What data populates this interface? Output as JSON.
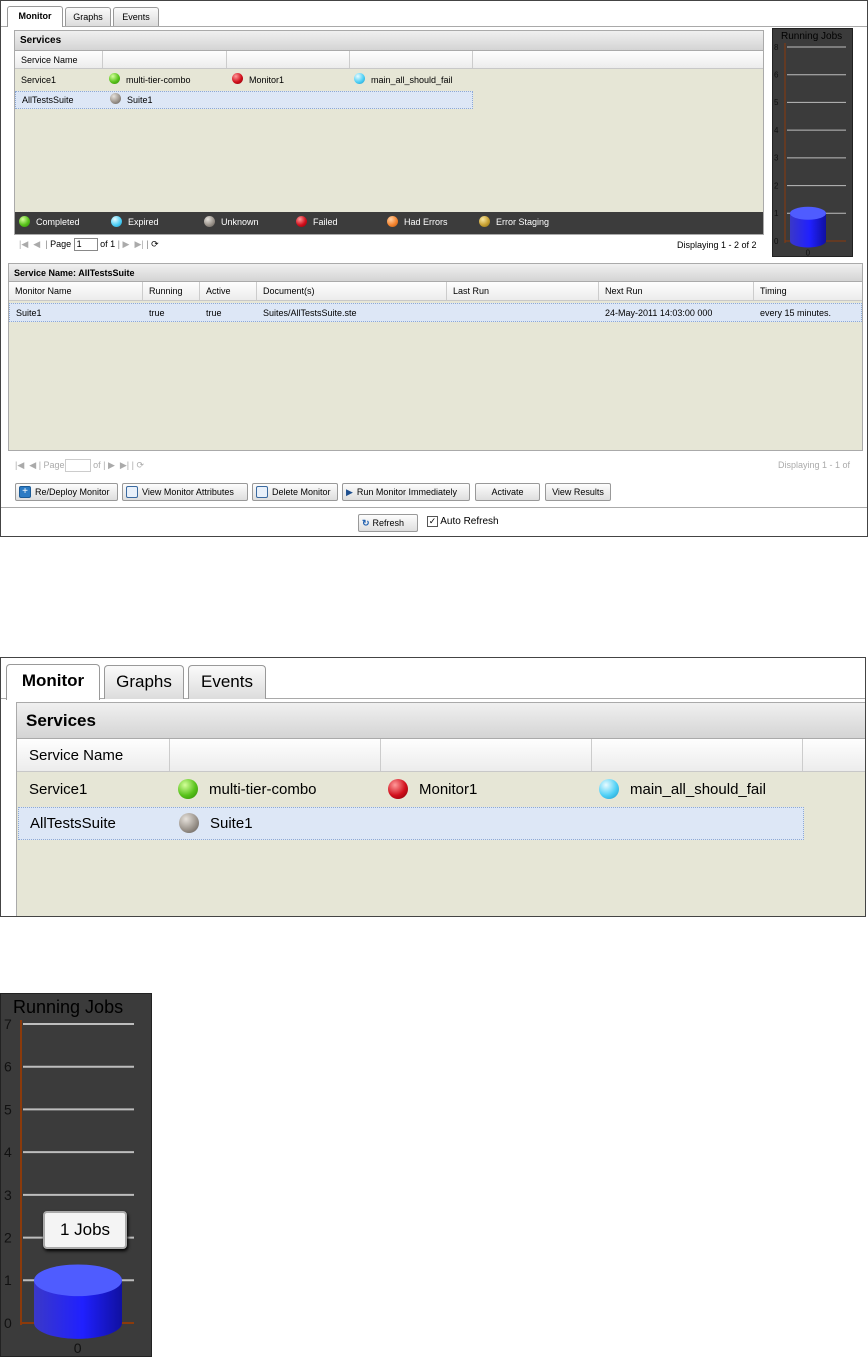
{
  "tabs": [
    "Monitor",
    "Graphs",
    "Events"
  ],
  "services": {
    "title": "Services",
    "column_header": "Service Name",
    "rows": [
      {
        "name": "Service1",
        "monitors": [
          {
            "label": "multi-tier-combo",
            "status": "completed"
          },
          {
            "label": "Monitor1",
            "status": "failed"
          },
          {
            "label": "main_all_should_fail",
            "status": "expired"
          }
        ]
      },
      {
        "name": "AllTestsSuite",
        "monitors": [
          {
            "label": "Suite1",
            "status": "unknown"
          }
        ]
      }
    ]
  },
  "legend": [
    "Completed",
    "Expired",
    "Unknown",
    "Failed",
    "Had Errors",
    "Error Staging"
  ],
  "status_colors": {
    "completed": "#58c21b",
    "expired": "#4fd0f6",
    "unknown": "#9c958d",
    "failed": "#d10f1c",
    "had_errors": "#f58530",
    "error_staging": "#c8a032"
  },
  "services_pager": {
    "page_label": "Page",
    "page_value": "1",
    "of": "of 1",
    "display": "Displaying 1 - 2 of 2"
  },
  "chart_data": {
    "type": "bar",
    "title": "Running Jobs",
    "categories": [
      "0"
    ],
    "values": [
      1
    ],
    "ylim": [
      0,
      7
    ],
    "yticks_main": [
      "0",
      "1",
      "2",
      "3",
      "4",
      "5",
      "6",
      "8"
    ],
    "yticks_zoom": [
      "0",
      "1",
      "2",
      "3",
      "4",
      "5",
      "6",
      "7"
    ],
    "tooltip": "1 Jobs",
    "grid": true
  },
  "detail": {
    "title": "Service Name: AllTestsSuite",
    "columns": [
      "Monitor Name",
      "Running",
      "Active",
      "Document(s)",
      "Last Run",
      "Next Run",
      "Timing"
    ],
    "rows": [
      [
        "Suite1",
        "true",
        "true",
        "Suites/AllTestsSuite.ste",
        "",
        "24-May-2011 14:03:00 000",
        "every 15 minutes."
      ]
    ]
  },
  "detail_pager": {
    "page_label": "Page",
    "of": "of",
    "display": "Displaying 1 - 1 of"
  },
  "buttons": [
    "Re/Deploy Monitor",
    "View Monitor Attributes",
    "Delete Monitor",
    "Run Monitor Immediately",
    "Activate",
    "View Results"
  ],
  "refresh": {
    "button": "Refresh",
    "checkbox_label": "Auto Refresh",
    "checked": true
  }
}
